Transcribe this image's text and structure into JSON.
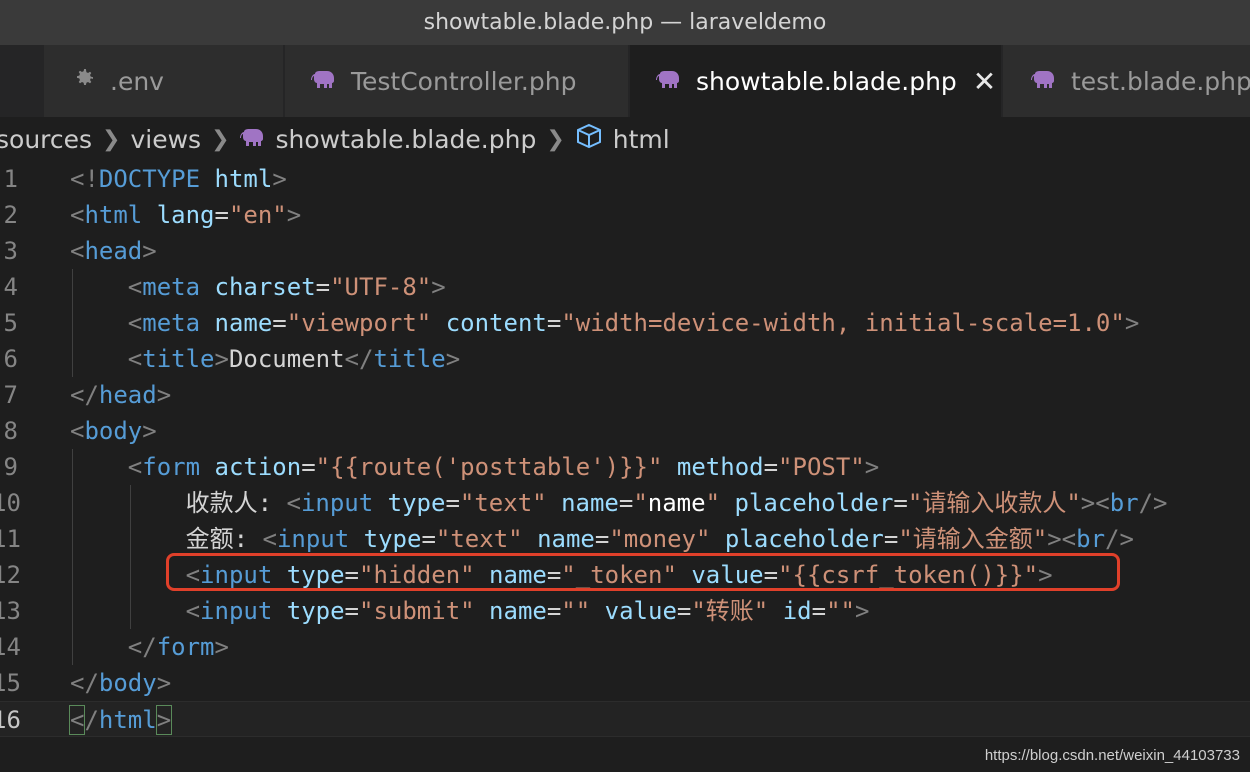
{
  "window": {
    "title": "showtable.blade.php — laraveldemo"
  },
  "tabs": [
    {
      "label": ".env",
      "icon": "gear-icon"
    },
    {
      "label": "TestController.php",
      "icon": "php-elephant-icon"
    },
    {
      "label": "showtable.blade.php",
      "icon": "php-elephant-icon",
      "active": true
    },
    {
      "label": "test.blade.php",
      "icon": "php-elephant-icon"
    }
  ],
  "breadcrumb": {
    "items": [
      "sources",
      "views",
      "showtable.blade.php",
      "html"
    ]
  },
  "editor": {
    "current_line": 16,
    "lines": [
      {
        "n": "1",
        "parts": [
          [
            "punc",
            "<!"
          ],
          [
            "tag",
            "DOCTYPE"
          ],
          [
            "txt",
            " "
          ],
          [
            "attr",
            "html"
          ],
          [
            "punc",
            ">"
          ]
        ]
      },
      {
        "n": "2",
        "parts": [
          [
            "punc",
            "<"
          ],
          [
            "tag",
            "html"
          ],
          [
            "txt",
            " "
          ],
          [
            "attr",
            "lang"
          ],
          [
            "eq",
            "="
          ],
          [
            "str",
            "\"en\""
          ],
          [
            "punc",
            ">"
          ]
        ]
      },
      {
        "n": "3",
        "parts": [
          [
            "punc",
            "<"
          ],
          [
            "tag",
            "head"
          ],
          [
            "punc",
            ">"
          ]
        ]
      },
      {
        "n": "4",
        "parts": [
          [
            "txt",
            "    "
          ],
          [
            "punc",
            "<"
          ],
          [
            "tag",
            "meta"
          ],
          [
            "txt",
            " "
          ],
          [
            "attr",
            "charset"
          ],
          [
            "eq",
            "="
          ],
          [
            "str",
            "\"UTF-8\""
          ],
          [
            "punc",
            ">"
          ]
        ]
      },
      {
        "n": "5",
        "parts": [
          [
            "txt",
            "    "
          ],
          [
            "punc",
            "<"
          ],
          [
            "tag",
            "meta"
          ],
          [
            "txt",
            " "
          ],
          [
            "attr",
            "name"
          ],
          [
            "eq",
            "="
          ],
          [
            "str",
            "\"viewport\""
          ],
          [
            "txt",
            " "
          ],
          [
            "attr",
            "content"
          ],
          [
            "eq",
            "="
          ],
          [
            "str",
            "\"width=device-width, initial-scale=1.0\""
          ],
          [
            "punc",
            ">"
          ]
        ]
      },
      {
        "n": "6",
        "parts": [
          [
            "txt",
            "    "
          ],
          [
            "punc",
            "<"
          ],
          [
            "tag",
            "title"
          ],
          [
            "punc",
            ">"
          ],
          [
            "txt",
            "Document"
          ],
          [
            "punc",
            "</"
          ],
          [
            "tag",
            "title"
          ],
          [
            "punc",
            ">"
          ]
        ]
      },
      {
        "n": "7",
        "parts": [
          [
            "punc",
            "</"
          ],
          [
            "tag",
            "head"
          ],
          [
            "punc",
            ">"
          ]
        ]
      },
      {
        "n": "8",
        "parts": [
          [
            "punc",
            "<"
          ],
          [
            "tag",
            "body"
          ],
          [
            "punc",
            ">"
          ]
        ]
      },
      {
        "n": "9",
        "parts": [
          [
            "txt",
            "    "
          ],
          [
            "punc",
            "<"
          ],
          [
            "tag",
            "form"
          ],
          [
            "txt",
            " "
          ],
          [
            "attr",
            "action"
          ],
          [
            "eq",
            "="
          ],
          [
            "str",
            "\"{{route('posttable')}}\""
          ],
          [
            "txt",
            " "
          ],
          [
            "attr",
            "method"
          ],
          [
            "eq",
            "="
          ],
          [
            "str",
            "\"POST\""
          ],
          [
            "punc",
            ">"
          ]
        ]
      },
      {
        "n": "10",
        "parts": [
          [
            "txt",
            "        收款人: "
          ],
          [
            "punc",
            "<"
          ],
          [
            "tag",
            "input"
          ],
          [
            "txt",
            " "
          ],
          [
            "attr",
            "type"
          ],
          [
            "eq",
            "="
          ],
          [
            "str",
            "\"text\""
          ],
          [
            "txt",
            " "
          ],
          [
            "attr",
            "name"
          ],
          [
            "eq",
            "="
          ],
          [
            "str",
            "\""
          ],
          [
            "bold",
            "name"
          ],
          [
            "str",
            "\""
          ],
          [
            "txt",
            " "
          ],
          [
            "attr",
            "placeholder"
          ],
          [
            "eq",
            "="
          ],
          [
            "str",
            "\"请输入收款人\""
          ],
          [
            "punc",
            "><"
          ],
          [
            "tag",
            "br"
          ],
          [
            "punc",
            "/>"
          ]
        ]
      },
      {
        "n": "11",
        "parts": [
          [
            "txt",
            "        金额: "
          ],
          [
            "punc",
            "<"
          ],
          [
            "tag",
            "input"
          ],
          [
            "txt",
            " "
          ],
          [
            "attr",
            "type"
          ],
          [
            "eq",
            "="
          ],
          [
            "str",
            "\"text\""
          ],
          [
            "txt",
            " "
          ],
          [
            "attr",
            "name"
          ],
          [
            "eq",
            "="
          ],
          [
            "str",
            "\"money\""
          ],
          [
            "txt",
            " "
          ],
          [
            "attr",
            "placeholder"
          ],
          [
            "eq",
            "="
          ],
          [
            "str",
            "\"请输入金额\""
          ],
          [
            "punc",
            "><"
          ],
          [
            "tag",
            "br"
          ],
          [
            "punc",
            "/>"
          ]
        ]
      },
      {
        "n": "12",
        "parts": [
          [
            "txt",
            "        "
          ],
          [
            "punc",
            "<"
          ],
          [
            "tag",
            "input"
          ],
          [
            "txt",
            " "
          ],
          [
            "attr",
            "type"
          ],
          [
            "eq",
            "="
          ],
          [
            "str",
            "\"hidden\""
          ],
          [
            "txt",
            " "
          ],
          [
            "attr",
            "name"
          ],
          [
            "eq",
            "="
          ],
          [
            "str",
            "\"_token\""
          ],
          [
            "txt",
            " "
          ],
          [
            "attr",
            "value"
          ],
          [
            "eq",
            "="
          ],
          [
            "str",
            "\"{{csrf_token()}}\""
          ],
          [
            "punc",
            ">"
          ]
        ]
      },
      {
        "n": "13",
        "parts": [
          [
            "txt",
            "        "
          ],
          [
            "punc",
            "<"
          ],
          [
            "tag",
            "input"
          ],
          [
            "txt",
            " "
          ],
          [
            "attr",
            "type"
          ],
          [
            "eq",
            "="
          ],
          [
            "str",
            "\"submit\""
          ],
          [
            "txt",
            " "
          ],
          [
            "attr",
            "name"
          ],
          [
            "eq",
            "="
          ],
          [
            "str",
            "\"\""
          ],
          [
            "txt",
            " "
          ],
          [
            "attr",
            "value"
          ],
          [
            "eq",
            "="
          ],
          [
            "str",
            "\"转账\""
          ],
          [
            "txt",
            " "
          ],
          [
            "attr",
            "id"
          ],
          [
            "eq",
            "="
          ],
          [
            "str",
            "\"\""
          ],
          [
            "punc",
            ">"
          ]
        ]
      },
      {
        "n": "14",
        "parts": [
          [
            "txt",
            "    "
          ],
          [
            "punc",
            "</"
          ],
          [
            "tag",
            "form"
          ],
          [
            "punc",
            ">"
          ]
        ]
      },
      {
        "n": "15",
        "parts": [
          [
            "punc",
            "</"
          ],
          [
            "tag",
            "body"
          ],
          [
            "punc",
            ">"
          ]
        ]
      },
      {
        "n": "16",
        "parts": [
          [
            "bracket",
            "<"
          ],
          [
            "punc",
            "/"
          ],
          [
            "tag",
            "html"
          ],
          [
            "bracket",
            ">"
          ]
        ]
      }
    ]
  },
  "watermark": "https://blog.csdn.net/weixin_44103733",
  "colors": {
    "tag": "#569cd6",
    "attr": "#9cdcfe",
    "string": "#ce9178",
    "highlight_box": "#e0402a"
  }
}
